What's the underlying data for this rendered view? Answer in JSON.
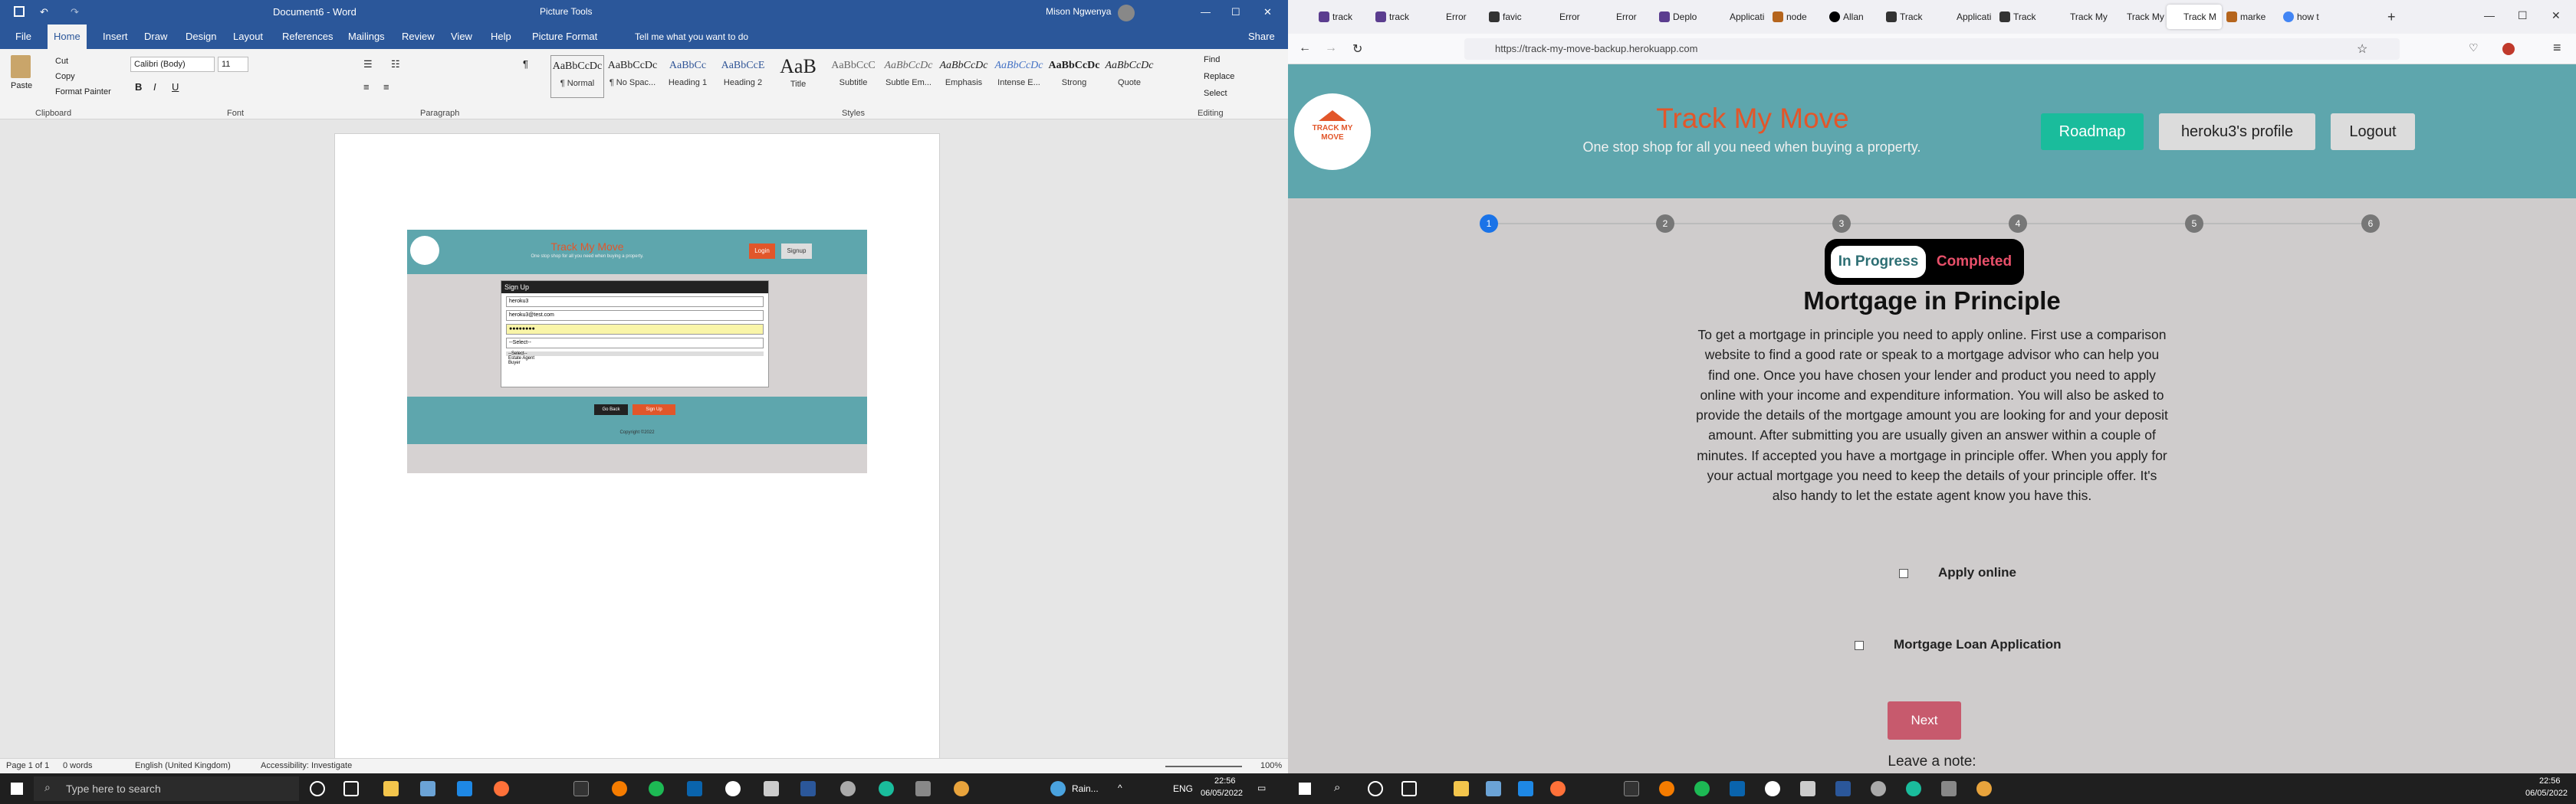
{
  "word": {
    "doc_title": "Document6 - Word",
    "picture_tools": "Picture Tools",
    "picture_format": "Picture Format",
    "tell_me": "Tell me what you want to do",
    "user": "Mison Ngwenya",
    "share": "Share",
    "tabs": [
      "File",
      "Home",
      "Insert",
      "Draw",
      "Design",
      "Layout",
      "References",
      "Mailings",
      "Review",
      "View",
      "Help"
    ],
    "clipboard": {
      "paste": "Paste",
      "cut": "Cut",
      "copy": "Copy",
      "format_painter": "Format Painter",
      "label": "Clipboard"
    },
    "font": {
      "name": "Calibri (Body)",
      "size": "11",
      "label": "Font"
    },
    "paragraph_label": "Paragraph",
    "styles_label": "Styles",
    "styles": [
      {
        "preview": "AaBbCcDc",
        "name": "¶ Normal"
      },
      {
        "preview": "AaBbCcDc",
        "name": "¶ No Spac..."
      },
      {
        "preview": "AaBbCc",
        "name": "Heading 1"
      },
      {
        "preview": "AaBbCcE",
        "name": "Heading 2"
      },
      {
        "preview": "AaB",
        "name": "Title"
      },
      {
        "preview": "AaBbCcC",
        "name": "Subtitle"
      },
      {
        "preview": "AaBbCcDc",
        "name": "Subtle Em..."
      },
      {
        "preview": "AaBbCcDc",
        "name": "Emphasis"
      },
      {
        "preview": "AaBbCcDc",
        "name": "Intense E..."
      },
      {
        "preview": "AaBbCcDc",
        "name": "Strong"
      },
      {
        "preview": "AaBbCcDc",
        "name": "Quote"
      }
    ],
    "editing": {
      "find": "Find",
      "replace": "Replace",
      "select": "Select",
      "label": "Editing"
    },
    "status": {
      "page": "Page 1 of 1",
      "words": "0 words",
      "language": "English (United Kingdom)",
      "accessibility": "Accessibility: Investigate",
      "zoom": "100%"
    },
    "embedded": {
      "title": "Track My Move",
      "subtitle": "One stop shop for all you need when buying a property.",
      "login": "Login",
      "signup": "Signup",
      "form_title": "Sign Up",
      "field1": "heroku3",
      "field2": "heroku3@test.com",
      "field3": "●●●●●●●●",
      "select": "--Select--",
      "options": [
        "--Select--",
        "Estate Agent",
        "Buyer"
      ],
      "go_back": "Go Back",
      "sign_up": "Sign Up",
      "copyright": "Copyright ©2022"
    }
  },
  "browser": {
    "tabs": [
      "track",
      "track",
      "Error",
      "favic",
      "Error",
      "Error",
      "Deplo",
      "Applicati",
      "node",
      "Allan",
      "Track",
      "Applicati",
      "Track",
      "Track My",
      "Track My",
      "Track M",
      "marke",
      "how t"
    ],
    "url": "https://track-my-move-backup.herokuapp.com"
  },
  "site": {
    "logo_text": "TRACK MY MOVE",
    "title": "Track My Move",
    "subtitle": "One stop shop for all you need when buying a property.",
    "nav": {
      "roadmap": "Roadmap",
      "profile": "heroku3's profile",
      "logout": "Logout"
    },
    "steps": [
      "1",
      "2",
      "3",
      "4",
      "5",
      "6"
    ],
    "toggle": {
      "in_progress": "In Progress",
      "completed": "Completed"
    },
    "heading": "Mortgage in Principle",
    "paragraph": "To get a mortgage in principle you need to apply online. First use a comparison website to find a good rate or speak to a mortgage advisor who can help you find one. Once you have chosen your lender and product you need to apply online with your income and expenditure information. You will also be asked to provide the details of the mortgage amount you are looking for and your deposit amount. After submitting you are usually given an answer within a couple of minutes. If accepted you have a mortgage in principle offer. When you apply for your actual mortgage you need to keep the details of your principle offer. It's also handy to let the estate agent know you have this.",
    "tasks": [
      "Apply online",
      "Mortgage Loan Application"
    ],
    "next": "Next",
    "note_label": "Leave a note:"
  },
  "taskbar": {
    "search": "Type here to search",
    "weather": "Rain...",
    "lang": "ENG",
    "time": "22:56",
    "date": "06/05/2022"
  },
  "colors": {
    "word_blue": "#2b579a",
    "teal": "#5ea6ad",
    "orange": "#e2562a",
    "green": "#1abc9c",
    "next": "#c75a6d"
  }
}
